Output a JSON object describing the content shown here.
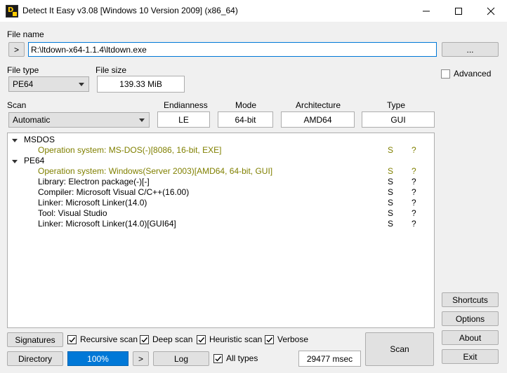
{
  "window": {
    "title": "Detect It Easy v3.08 [Windows 10 Version 2009] (x86_64)",
    "app_icon_letters": "DiE"
  },
  "file": {
    "label": "File name",
    "open_button": ">",
    "path": "R:\\ltdown-x64-1.1.4\\ltdown.exe",
    "browse_button": "..."
  },
  "file_type": {
    "label": "File type",
    "value": "PE64"
  },
  "file_size": {
    "label": "File size",
    "value": "139.33 MiB"
  },
  "scan": {
    "label": "Scan",
    "value": "Automatic"
  },
  "info": {
    "endianness": {
      "label": "Endianness",
      "value": "LE"
    },
    "mode": {
      "label": "Mode",
      "value": "64-bit"
    },
    "architecture": {
      "label": "Architecture",
      "value": "AMD64"
    },
    "type": {
      "label": "Type",
      "value": "GUI"
    }
  },
  "results": {
    "groups": [
      {
        "name": "MSDOS",
        "rows": [
          {
            "text": "Operation system: MS-DOS(-)[8086, 16-bit, EXE]",
            "s": "S",
            "q": "?",
            "highlight": true
          }
        ]
      },
      {
        "name": "PE64",
        "rows": [
          {
            "text": "Operation system: Windows(Server 2003)[AMD64, 64-bit, GUI]",
            "s": "S",
            "q": "?",
            "highlight": true
          },
          {
            "text": "Library: Electron package(-)[-]",
            "s": "S",
            "q": "?",
            "highlight": false
          },
          {
            "text": "Compiler: Microsoft Visual C/C++(16.00)",
            "s": "S",
            "q": "?",
            "highlight": false
          },
          {
            "text": "Linker: Microsoft Linker(14.0)",
            "s": "S",
            "q": "?",
            "highlight": false
          },
          {
            "text": "Tool: Visual Studio",
            "s": "S",
            "q": "?",
            "highlight": false
          },
          {
            "text": "Linker: Microsoft Linker(14.0)[GUI64]",
            "s": "S",
            "q": "?",
            "highlight": false
          }
        ]
      }
    ]
  },
  "sidebar": {
    "advanced_label": "Advanced",
    "advanced_checked": false,
    "shortcuts": "Shortcuts",
    "options": "Options",
    "about": "About",
    "exit": "Exit"
  },
  "bottom": {
    "signatures": "Signatures",
    "recursive_scan": "Recursive scan",
    "deep_scan": "Deep scan",
    "heuristic_scan": "Heuristic scan",
    "verbose": "Verbose",
    "directory": "Directory",
    "progress": "100%",
    "progress_fraction": 1.0,
    "next": ">",
    "log": "Log",
    "all_types": "All types",
    "elapsed": "29477 msec",
    "scan_button": "Scan"
  },
  "colors": {
    "highlight_text": "#808000",
    "progress_fill": "#0078d7",
    "focus_border": "#0078d7"
  }
}
